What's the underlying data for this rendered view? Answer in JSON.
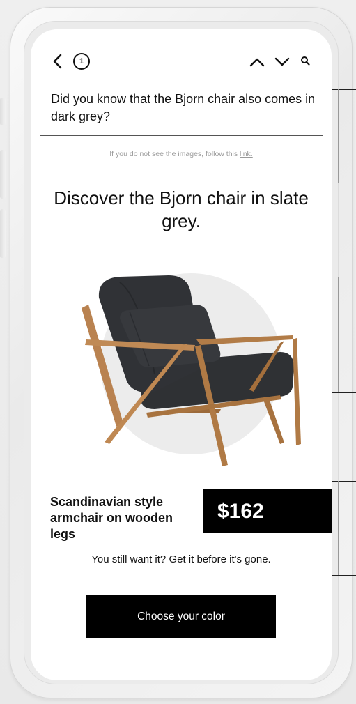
{
  "header": {
    "message_count": "1"
  },
  "email": {
    "subject": "Did you know that the Bjorn chair also comes in dark grey?",
    "notice_text": "If you do not see the images, follow this ",
    "notice_link": "link.",
    "headline": "Discover the Bjorn chair in slate grey.",
    "product_name": "Scandinavian style armchair on wooden legs",
    "price": "$162",
    "urgency": "You still want it? Get it before it's gone.",
    "cta_label": "Choose your color"
  },
  "colors": {
    "accent": "#000000",
    "chair_fabric": "#2f3134",
    "wood": "#b07a45",
    "backdrop_circle": "#ececec"
  },
  "icons": [
    "back-chevron-icon",
    "up-chevron-icon",
    "down-chevron-icon",
    "search-icon"
  ]
}
